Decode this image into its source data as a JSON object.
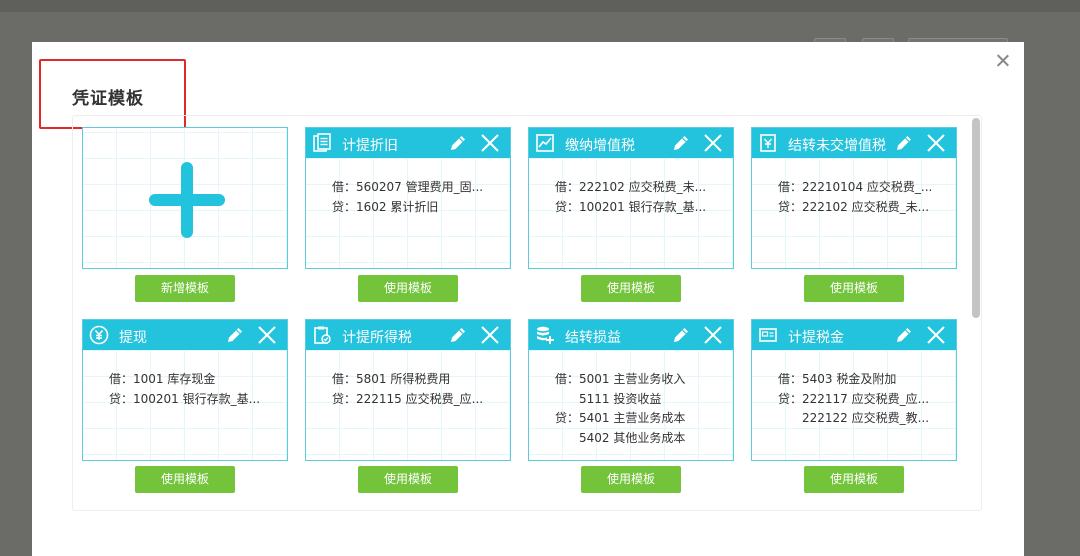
{
  "modal": {
    "title": "凭证模板",
    "close_icon": "close-icon"
  },
  "colors": {
    "header": "#23c3dd",
    "button": "#73c43b",
    "highlight_border": "#e02a2a"
  },
  "new_template": {
    "button_label": "新增模板",
    "icon": "plus-icon"
  },
  "templates": [
    {
      "title": "计提折旧",
      "icon": "document-list-icon",
      "lines": [
        "借：560207 管理费用_固...",
        "贷：1602 累计折旧"
      ],
      "button_label": "使用模板"
    },
    {
      "title": "缴纳增值税",
      "icon": "line-chart-icon",
      "lines": [
        "借：222102 应交税费_未...",
        "贷：100201 银行存款_基..."
      ],
      "button_label": "使用模板"
    },
    {
      "title": "结转未交增值税",
      "icon": "yen-transfer-icon",
      "lines": [
        "借：22210104 应交税费_...",
        "贷：222102 应交税费_未..."
      ],
      "button_label": "使用模板"
    },
    {
      "title": "提现",
      "icon": "yen-circle-icon",
      "lines": [
        "借：1001 库存现金",
        "贷：100201 银行存款_基..."
      ],
      "button_label": "使用模板"
    },
    {
      "title": "计提所得税",
      "icon": "clipboard-check-icon",
      "lines": [
        "借：5801 所得税费用",
        "贷：222115 应交税费_应..."
      ],
      "button_label": "使用模板"
    },
    {
      "title": "结转损益",
      "icon": "database-plus-icon",
      "lines": [
        "借：5001 主营业务收入",
        "　　5111 投资收益",
        "贷：5401 主营业务成本",
        "　　5402 其他业务成本"
      ],
      "button_label": "使用模板"
    },
    {
      "title": "计提税金",
      "icon": "tax-tag-icon",
      "lines": [
        "借：5403 税金及附加",
        "贷：222117 应交税费_应...",
        "　　222122 应交税费_教..."
      ],
      "button_label": "使用模板"
    }
  ]
}
